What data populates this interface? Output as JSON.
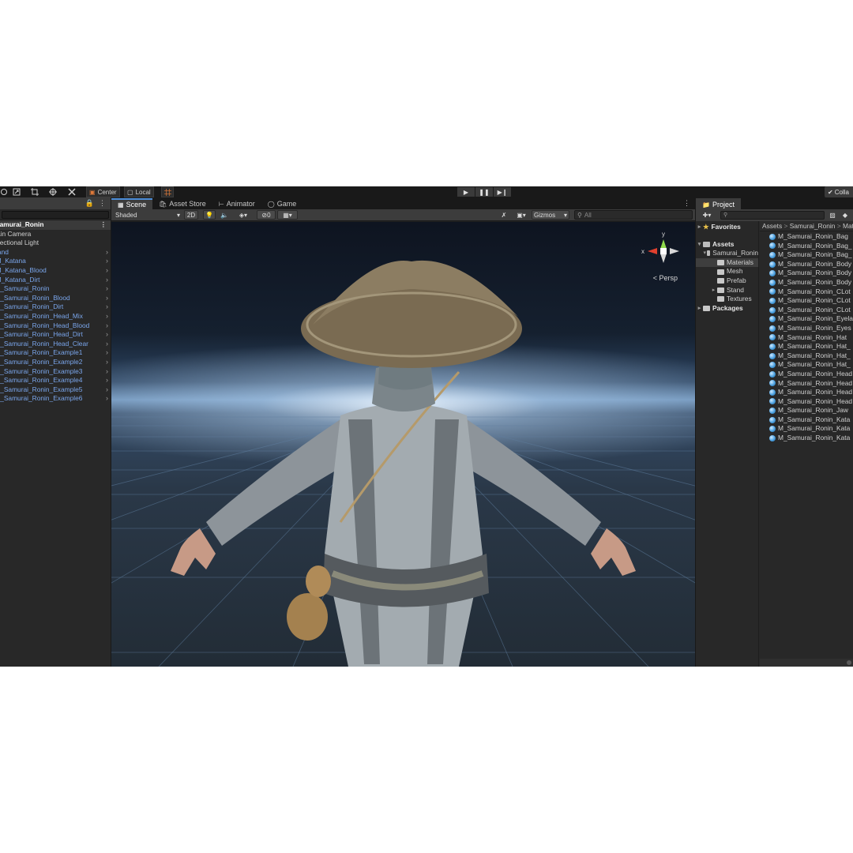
{
  "toolbar": {
    "pivot_center": "Center",
    "pivot_local": "Local",
    "play_icon": "play-icon",
    "pause_icon": "pause-icon",
    "step_icon": "step-icon",
    "collab_label": "Colla"
  },
  "hierarchy": {
    "root": "Samurai_Ronin",
    "items": [
      {
        "label": "Main Camera",
        "kind": "plain"
      },
      {
        "label": "Directional Light",
        "kind": "plain"
      },
      {
        "label": "Stand",
        "kind": "prefab"
      },
      {
        "label": "SM_Katana",
        "kind": "prefab"
      },
      {
        "label": "SM_Katana_Blood",
        "kind": "prefab"
      },
      {
        "label": "SM_Katana_Dirt",
        "kind": "prefab"
      },
      {
        "label": "SK_Samurai_Ronin",
        "kind": "prefab"
      },
      {
        "label": "SK_Samurai_Ronin_Blood",
        "kind": "prefab"
      },
      {
        "label": "SK_Samurai_Ronin_Dirt",
        "kind": "prefab"
      },
      {
        "label": "SK_Samurai_Ronin_Head_Mix",
        "kind": "prefab"
      },
      {
        "label": "SK_Samurai_Ronin_Head_Blood",
        "kind": "prefab"
      },
      {
        "label": "SK_Samurai_Ronin_Head_Dirt",
        "kind": "prefab"
      },
      {
        "label": "SK_Samurai_Ronin_Head_Clear",
        "kind": "prefab"
      },
      {
        "label": "SK_Samurai_Ronin_Example1",
        "kind": "prefab"
      },
      {
        "label": "SK_Samurai_Ronin_Example2",
        "kind": "prefab"
      },
      {
        "label": "SK_Samurai_Ronin_Example3",
        "kind": "prefab"
      },
      {
        "label": "SK_Samurai_Ronin_Example4",
        "kind": "prefab"
      },
      {
        "label": "SK_Samurai_Ronin_Example5",
        "kind": "prefab"
      },
      {
        "label": "SK_Samurai_Ronin_Example6",
        "kind": "prefab"
      }
    ]
  },
  "scene": {
    "tabs": [
      {
        "label": "Scene",
        "icon": "grid-icon"
      },
      {
        "label": "Asset Store",
        "icon": "bag-icon"
      },
      {
        "label": "Animator",
        "icon": "animator-icon"
      },
      {
        "label": "Game",
        "icon": "gamepad-icon"
      }
    ],
    "draw_mode": "Shaded",
    "mode_2d": "2D",
    "hidden_count": "0",
    "gizmos_label": "Gizmos",
    "search_placeholder": "All",
    "projection": "< Persp",
    "axis_x": "x",
    "axis_y": "y"
  },
  "project": {
    "tab_label": "Project",
    "favorites": "Favorites",
    "assets": "Assets",
    "tree": [
      {
        "label": "Samurai_Ronin",
        "level": 1,
        "open": true
      },
      {
        "label": "Materials",
        "level": 2,
        "selected": true
      },
      {
        "label": "Mesh",
        "level": 2
      },
      {
        "label": "Prefab",
        "level": 2
      },
      {
        "label": "Stand",
        "level": 2,
        "collapsed": true
      },
      {
        "label": "Textures",
        "level": 2
      }
    ],
    "packages": "Packages",
    "breadcrumb": [
      "Assets",
      "Samurai_Ronin",
      "Materials"
    ],
    "files": [
      "M_Samurai_Ronin_Bag",
      "M_Samurai_Ronin_Bag_",
      "M_Samurai_Ronin_Bag_",
      "M_Samurai_Ronin_Body",
      "M_Samurai_Ronin_Body",
      "M_Samurai_Ronin_Body",
      "M_Samurai_Ronin_CLot",
      "M_Samurai_Ronin_CLot",
      "M_Samurai_Ronin_CLot",
      "M_Samurai_Ronin_Eyela",
      "M_Samurai_Ronin_Eyes",
      "M_Samurai_Ronin_Hat",
      "M_Samurai_Ronin_Hat_",
      "M_Samurai_Ronin_Hat_",
      "M_Samurai_Ronin_Hat_",
      "M_Samurai_Ronin_Head",
      "M_Samurai_Ronin_Head",
      "M_Samurai_Ronin_Head",
      "M_Samurai_Ronin_Head",
      "M_Samurai_Ronin_Jaw",
      "M_Samurai_Ronin_Kata",
      "M_Samurai_Ronin_Kata",
      "M_Samurai_Ronin_Kata"
    ]
  },
  "colors": {
    "accent": "#4d8ed8",
    "prefab_text": "#7aa6ec",
    "panel_bg": "#282828",
    "toolbar_bg": "#191919"
  }
}
